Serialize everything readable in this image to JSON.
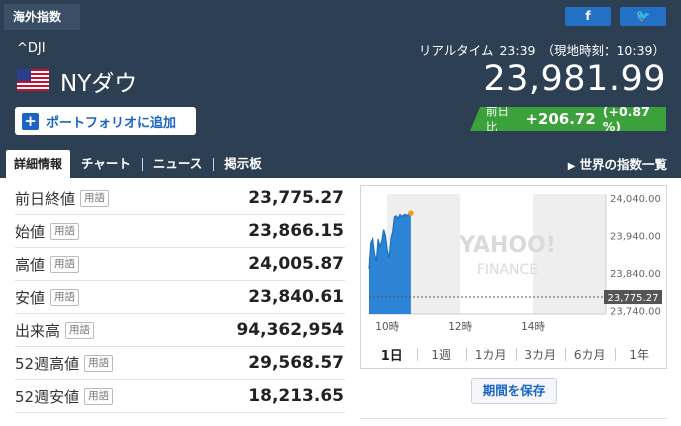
{
  "header": {
    "tag": "海外指数",
    "share_fb": "f",
    "share_tw": "🐦",
    "symbol": "^DJI",
    "name": "NYダウ",
    "realtime_label": "リアルタイム",
    "time": "23:39",
    "local_time": "（現地時刻：10:39）",
    "price": "23,981.99",
    "portfolio_label": "ポートフォリオに追加",
    "change_label": "前日比",
    "change_value": "+206.72",
    "change_pct": "(+0.87 %)"
  },
  "tabs": {
    "active": "詳細情報",
    "items": [
      "チャート",
      "ニュース",
      "掲示板"
    ],
    "world_link": "世界の指数一覧"
  },
  "stats": [
    {
      "label": "前日終値",
      "term": "用語",
      "value": "23,775.27"
    },
    {
      "label": "始値",
      "term": "用語",
      "value": "23,866.15"
    },
    {
      "label": "高値",
      "term": "用語",
      "value": "24,005.87"
    },
    {
      "label": "安値",
      "term": "用語",
      "value": "23,840.61"
    },
    {
      "label": "出来高",
      "term": "用語",
      "value": "94,362,954"
    },
    {
      "label": "52週高値",
      "term": "用語",
      "value": "29,568.57"
    },
    {
      "label": "52週安値",
      "term": "用語",
      "value": "18,213.65"
    }
  ],
  "chart": {
    "watermark": "YAHOO!",
    "watermark_sub": "FINANCE",
    "prev_close_label": "23,775.27",
    "ranges": [
      "1日",
      "1週",
      "1カ月",
      "3カ月",
      "6カ月",
      "1年"
    ],
    "active_range": "1日",
    "save_label": "期間を保存"
  },
  "chart_data": {
    "type": "area",
    "x_ticks": [
      "10時",
      "12時",
      "14時"
    ],
    "y_ticks": [
      24040,
      23940,
      23840,
      23740
    ],
    "ylim": [
      23730,
      24050
    ],
    "prev_close": 23775.27,
    "x": [
      9.5,
      9.55,
      9.6,
      9.65,
      9.7,
      9.75,
      9.8,
      9.85,
      9.9,
      9.95,
      10.0,
      10.05,
      10.1,
      10.15,
      10.2,
      10.25,
      10.3,
      10.35,
      10.4,
      10.45,
      10.5,
      10.55,
      10.6,
      10.65
    ],
    "values": [
      23850,
      23920,
      23930,
      23890,
      23870,
      23930,
      23910,
      23925,
      23955,
      23940,
      23900,
      23880,
      23930,
      23950,
      23990,
      23992,
      23985,
      23995,
      23990,
      23994,
      23996,
      23992,
      23998,
      23999
    ],
    "x_range": [
      9.5,
      16.0
    ],
    "accent": "#2b84d6",
    "last_point_color": "#f0a020"
  },
  "colors": {
    "header_bg": "#2d3f52",
    "up": "#3ba13b",
    "link": "#1a64c5"
  }
}
